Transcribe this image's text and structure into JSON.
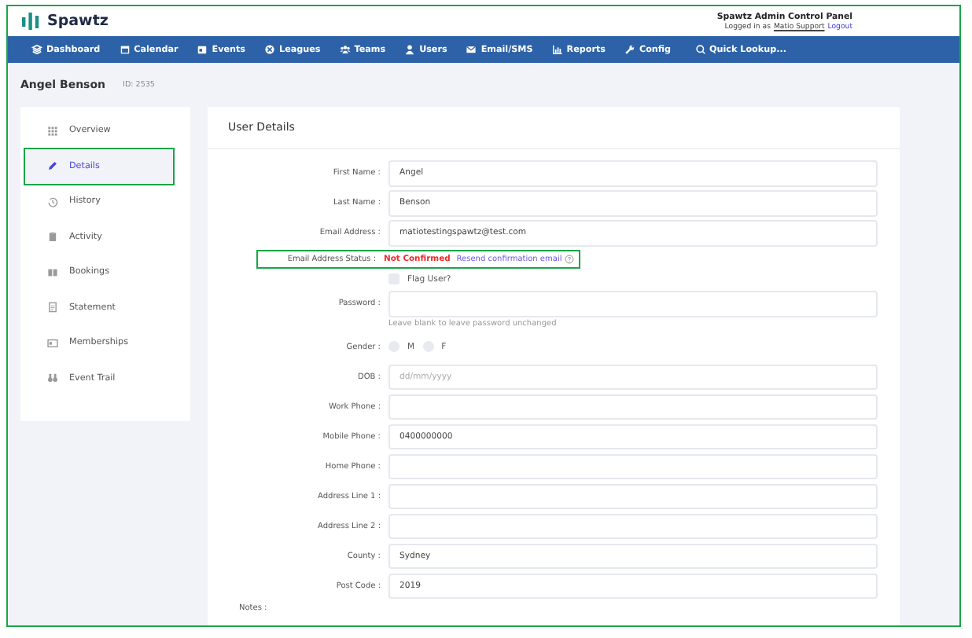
{
  "header": {
    "logo": "Spawtz",
    "panel_title": "Spawtz Admin Control Panel",
    "logged_in_prefix": "Logged in as",
    "user": "Matio Support",
    "logout": "Logout"
  },
  "nav": [
    {
      "label": "Dashboard"
    },
    {
      "label": "Calendar"
    },
    {
      "label": "Events"
    },
    {
      "label": "Leagues"
    },
    {
      "label": "Teams"
    },
    {
      "label": "Users"
    },
    {
      "label": "Email/SMS"
    },
    {
      "label": "Reports"
    },
    {
      "label": "Config"
    }
  ],
  "quick_lookup": "Quick Lookup...",
  "page": {
    "name": "Angel Benson",
    "id": "ID: 2535"
  },
  "sidebar": [
    {
      "label": "Overview",
      "selected": false,
      "highlighted": false
    },
    {
      "label": "Details",
      "selected": true,
      "highlighted": true
    },
    {
      "label": "History",
      "selected": false,
      "highlighted": false
    },
    {
      "label": "Activity",
      "selected": false,
      "highlighted": false
    },
    {
      "label": "Bookings",
      "selected": false,
      "highlighted": false
    },
    {
      "label": "Statement",
      "selected": false,
      "highlighted": false
    },
    {
      "label": "Memberships",
      "selected": false,
      "highlighted": false
    },
    {
      "label": "Event Trail",
      "selected": false,
      "highlighted": false
    }
  ],
  "card_title": "User Details",
  "fields": [
    {
      "kind": "text",
      "label": "First Name :",
      "value": "Angel"
    },
    {
      "kind": "text",
      "label": "Last Name :",
      "value": "Benson"
    },
    {
      "kind": "text",
      "label": "Email Address :",
      "value": "matiotestingspawtz@test.com"
    },
    {
      "kind": "status",
      "label": "Email Address Status :",
      "status": "Not Confirmed",
      "link": "Resend confirmation email",
      "highlighted": true
    },
    {
      "kind": "checkbox",
      "label": "Flag User?",
      "checked": false
    },
    {
      "kind": "password",
      "label": "Password :",
      "help": "Leave blank to leave password unchanged"
    },
    {
      "kind": "radio",
      "label": "Gender :",
      "options": [
        {
          "label": "M",
          "selected": false
        },
        {
          "label": "F",
          "selected": false
        }
      ]
    },
    {
      "kind": "text",
      "label": "DOB :",
      "placeholder": "dd/mm/yyyy"
    },
    {
      "kind": "text",
      "label": "Work Phone :"
    },
    {
      "kind": "text",
      "label": "Mobile Phone :",
      "value": "0400000000"
    },
    {
      "kind": "text",
      "label": "Home Phone :"
    },
    {
      "kind": "text",
      "label": "Address Line 1 :"
    },
    {
      "kind": "text",
      "label": "Address Line 2 :"
    },
    {
      "kind": "text",
      "label": "County :",
      "value": "Sydney"
    },
    {
      "kind": "text",
      "label": "Post Code :",
      "value": "2019"
    }
  ],
  "notes_label": "Notes :"
}
